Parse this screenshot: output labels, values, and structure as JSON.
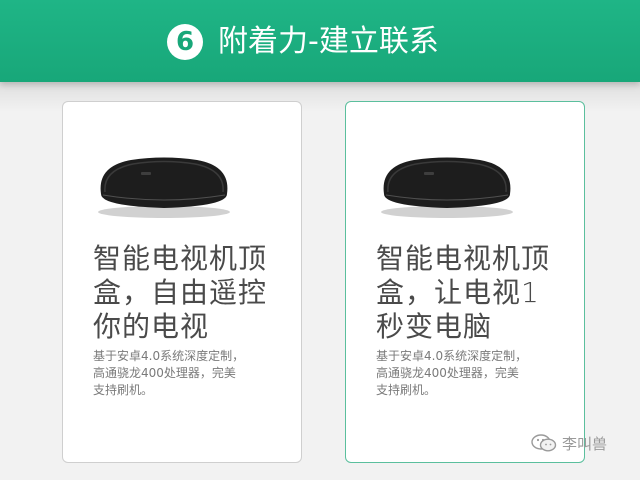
{
  "header": {
    "step_number": "6",
    "title": "附着力-建立联系",
    "accent_color": "#1fb586"
  },
  "cards": [
    {
      "icon": "tv-box-device-icon",
      "title_lines": [
        "智能电视机顶",
        "盒，自由遥控",
        "你的电视"
      ],
      "desc_lines": [
        "基于安卓4.0系统深度定制，",
        "高通骁龙400处理器，完美",
        "支持刷机。"
      ]
    },
    {
      "icon": "tv-box-device-icon",
      "title_lines": [
        "智能电视机顶",
        "盒，让电视1",
        "秒变电脑"
      ],
      "desc_lines": [
        "基于安卓4.0系统深度定制，",
        "高通骁龙400处理器，完美",
        "支持刷机。"
      ]
    }
  ],
  "watermark": {
    "icon": "wechat-icon",
    "text": "李叫兽"
  }
}
